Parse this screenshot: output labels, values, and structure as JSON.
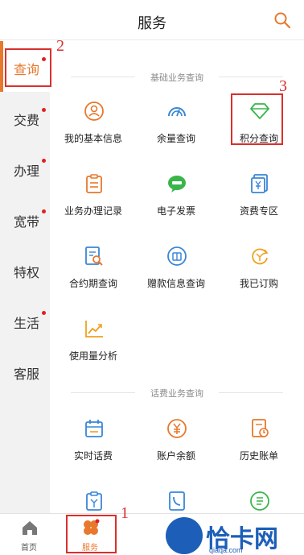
{
  "header": {
    "title": "服务",
    "search_icon": "search-icon"
  },
  "sidebar": {
    "items": [
      {
        "label": "查询",
        "active": true,
        "dot": true
      },
      {
        "label": "交费",
        "active": false,
        "dot": true
      },
      {
        "label": "办理",
        "active": false,
        "dot": true
      },
      {
        "label": "宽带",
        "active": false,
        "dot": true
      },
      {
        "label": "特权",
        "active": false,
        "dot": false
      },
      {
        "label": "生活",
        "active": false,
        "dot": true
      },
      {
        "label": "客服",
        "active": false,
        "dot": false
      }
    ]
  },
  "sections": [
    {
      "title": "基础业务查询",
      "items": [
        {
          "label": "我的基本信息",
          "icon": "user-info-icon"
        },
        {
          "label": "余量查询",
          "icon": "gauge-icon"
        },
        {
          "label": "积分查询",
          "icon": "diamond-icon"
        },
        {
          "label": "业务办理记录",
          "icon": "clipboard-icon"
        },
        {
          "label": "电子发票",
          "icon": "e-invoice-icon"
        },
        {
          "label": "资费专区",
          "icon": "tariff-icon"
        },
        {
          "label": "合约期查询",
          "icon": "contract-search-icon"
        },
        {
          "label": "赠款信息查询",
          "icon": "gift-money-icon"
        },
        {
          "label": "我已订购",
          "icon": "subscribed-icon"
        },
        {
          "label": "使用量分析",
          "icon": "usage-chart-icon"
        }
      ]
    },
    {
      "title": "话费业务查询",
      "items": [
        {
          "label": "实时话费",
          "icon": "calendar-icon"
        },
        {
          "label": "账户余额",
          "icon": "yuan-icon"
        },
        {
          "label": "历史账单",
          "icon": "bill-history-icon"
        },
        {
          "label": "",
          "icon": "bill-icon"
        },
        {
          "label": "",
          "icon": "call-record-icon"
        },
        {
          "label": "",
          "icon": "sms-icon"
        }
      ]
    }
  ],
  "tabbar": {
    "items": [
      {
        "label": "首页",
        "icon": "home-icon",
        "active": false
      },
      {
        "label": "服务",
        "icon": "service-icon",
        "active": true
      }
    ]
  },
  "annotations": [
    "1",
    "2",
    "3"
  ],
  "watermark": {
    "text": "恰卡网",
    "sub": "qiaqa.com"
  },
  "colors": {
    "accent": "#e8782c",
    "annotation": "#d9302c",
    "badge": "#e02020",
    "icon_orange": "#e8782c",
    "icon_green": "#3ab54a",
    "icon_blue": "#3a86d6"
  }
}
